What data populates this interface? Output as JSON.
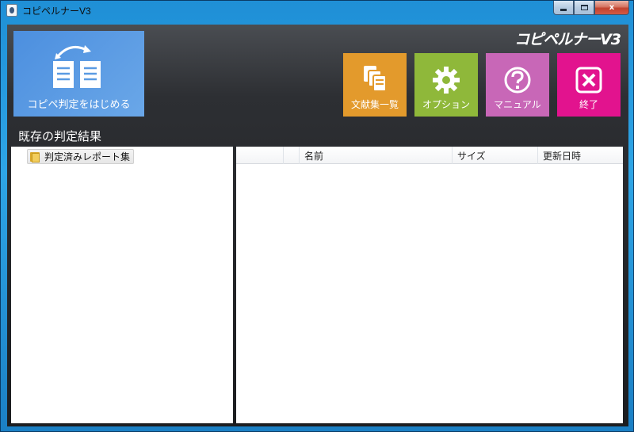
{
  "window": {
    "title": "コピペルナーV3",
    "minimize_glyph": "",
    "maximize_glyph": "",
    "close_glyph": "x"
  },
  "brand": "コピペルナーV3",
  "tiles": {
    "start": {
      "label": "コピペ判定をはじめる",
      "icon": "documents-cycle-icon",
      "color": "#5a9be3"
    },
    "documents": {
      "label": "文献集一覧",
      "icon": "document-stack-icon",
      "color": "#e39a2c"
    },
    "options": {
      "label": "オプション",
      "icon": "gear-icon",
      "color": "#8fb83a"
    },
    "manual": {
      "label": "マニュアル",
      "icon": "question-icon",
      "color": "#c867b7"
    },
    "exit": {
      "label": "終了",
      "icon": "close-box-icon",
      "color": "#e2138e"
    }
  },
  "section_title": "既存の判定結果",
  "tree": {
    "items": [
      {
        "label": "判定済みレポート集",
        "icon": "folder-icon"
      }
    ]
  },
  "list": {
    "columns": [
      "",
      "",
      "名前",
      "サイズ",
      "更新日時"
    ],
    "rows": []
  }
}
